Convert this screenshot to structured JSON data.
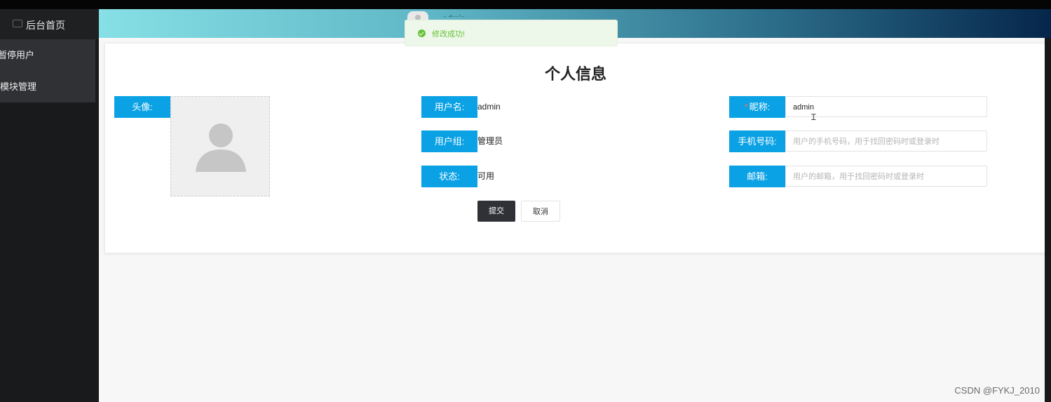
{
  "sidebar": {
    "home_label": "后台首页",
    "items": [
      {
        "label": "暂停用户"
      },
      {
        "label": "模块管理"
      }
    ]
  },
  "header": {
    "user_name": "admin"
  },
  "toast": {
    "message": "修改成功!",
    "color": "#67c23a"
  },
  "form": {
    "title": "个人信息",
    "avatar_label": "头像:",
    "username_label": "用户名:",
    "username_value": "admin",
    "group_label": "用户组:",
    "group_value": "管理员",
    "status_label": "状态:",
    "status_value": "可用",
    "nickname_label": "昵称:",
    "nickname_required_mark": "*",
    "nickname_value": "admin",
    "phone_label": "手机号码:",
    "phone_placeholder": "用户的手机号码，用于找回密码时或登录时",
    "email_label": "邮箱:",
    "email_placeholder": "用户的邮箱，用于找回密码时或登录时",
    "submit_label": "提交",
    "cancel_label": "取消",
    "label_color": "#0aa2e5"
  },
  "watermark": "CSDN @FYKJ_2010"
}
